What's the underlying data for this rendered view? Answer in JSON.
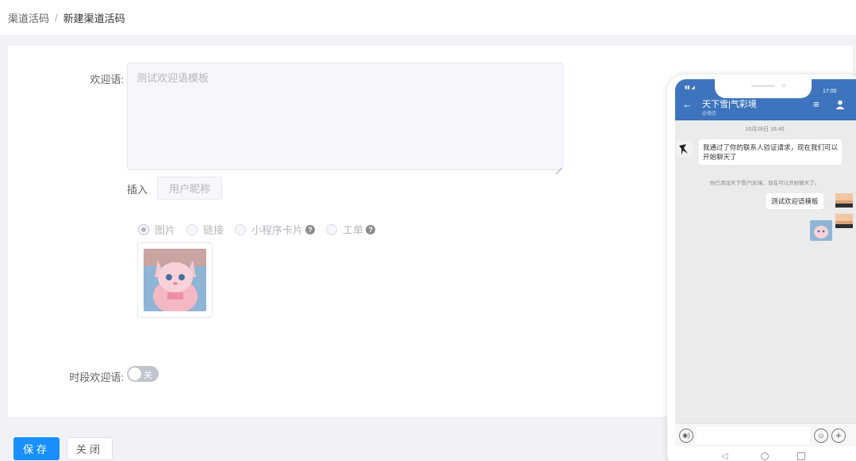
{
  "breadcrumb": {
    "parent": "渠道活码",
    "separator": "/",
    "current": "新建渠道活码"
  },
  "form": {
    "welcome_label": "欢迎语:",
    "welcome_value": "测试欢迎语模板",
    "insert_label": "插入",
    "nickname_button": "用户昵称",
    "attachment_types": [
      {
        "label": "图片",
        "checked": true,
        "help": false
      },
      {
        "label": "链接",
        "checked": false,
        "help": false
      },
      {
        "label": "小程序卡片",
        "checked": false,
        "help": true
      },
      {
        "label": "工单",
        "checked": false,
        "help": true
      }
    ],
    "help_glyph": "?",
    "period_label": "时段欢迎语:",
    "period_toggle_text": "关",
    "period_toggle_on": false
  },
  "actions": {
    "save": "保存",
    "close": "关闭"
  },
  "phone": {
    "status_right": "17:00",
    "back_glyph": "←",
    "menu_glyph": "≡",
    "chat_title": "天下雪|气彩境",
    "chat_subtitle": "@微信",
    "time": "10月28日 16:40",
    "incoming_message": "我通过了你的联系人验证请求，现在我们可以开始聊天了",
    "system_notice": "你已添加天下雪|气彩境，现在可以开始聊天了。",
    "outgoing_message": "测试欢迎语模板",
    "voice_glyph": "◉)",
    "emoji_glyph": "☺",
    "plus_glyph": "+",
    "nav_back_glyph": "◁"
  },
  "colors": {
    "primary": "#1890ff",
    "chat_header": "#3d74bd"
  }
}
